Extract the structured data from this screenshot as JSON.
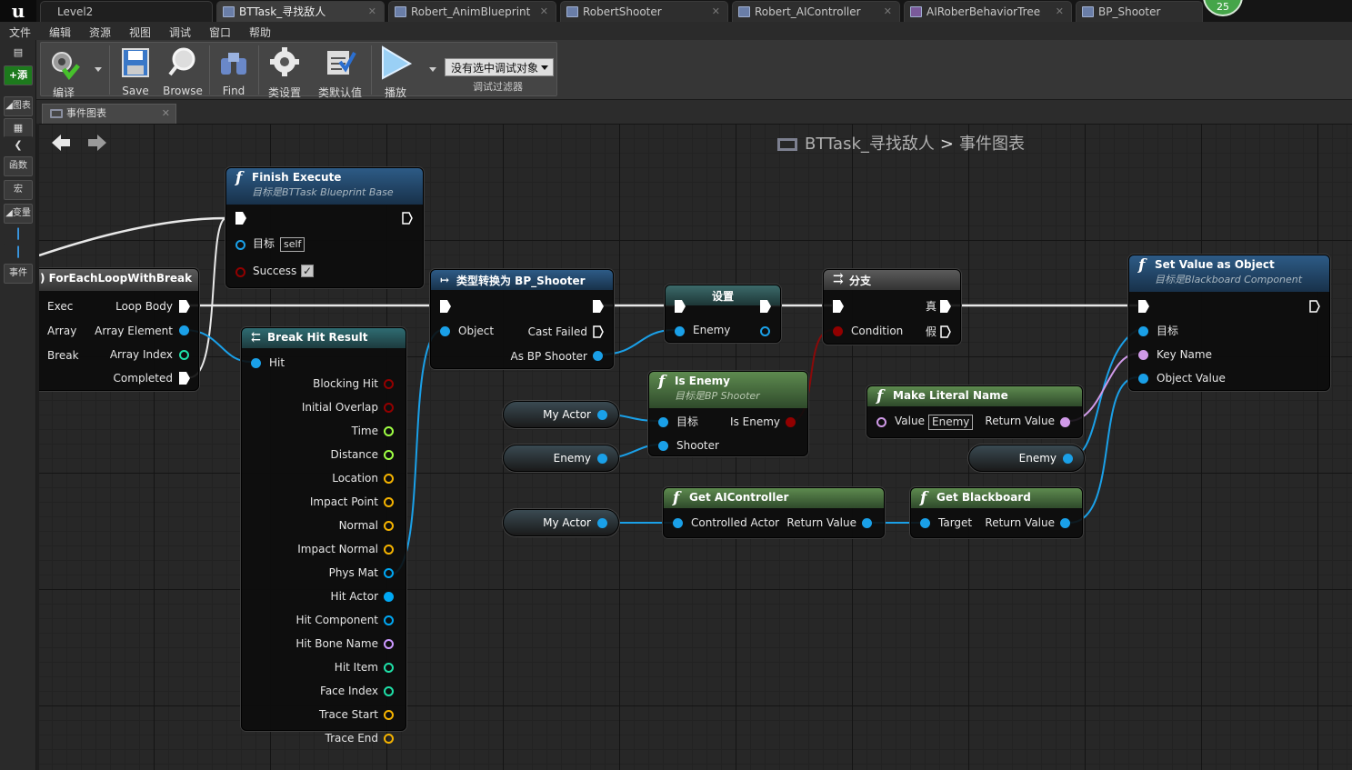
{
  "tabs": [
    {
      "label": "Level2"
    },
    {
      "label": "BTTask_寻找敌人"
    },
    {
      "label": "Robert_AnimBlueprint"
    },
    {
      "label": "RobertShooter"
    },
    {
      "label": "Robert_AIController"
    },
    {
      "label": "AIRoberBehaviorTree"
    },
    {
      "label": "BP_Shooter"
    }
  ],
  "notification_count": "25",
  "menu": [
    "文件",
    "编辑",
    "资源",
    "视图",
    "调试",
    "窗口",
    "帮助"
  ],
  "left_panel": {
    "add_label": "添",
    "items": [
      "图表",
      "函数",
      "宏",
      "变量",
      "事件"
    ]
  },
  "toolbar": {
    "compile": "编译",
    "save": "Save",
    "browse": "Browse",
    "find": "Find",
    "class_settings": "类设置",
    "class_defaults": "类默认值",
    "play": "播放",
    "debug_object": "没有选中调试对象",
    "debug_filter": "调试过滤器"
  },
  "graph_tab": "事件图表",
  "breadcrumb": {
    "asset": "BTTask_寻找敌人",
    "sep": ">",
    "graph": "事件图表"
  },
  "nodes": {
    "finish_execute": {
      "title": "Finish Execute",
      "subtitle": "目标是BTTask Blueprint Base",
      "target": "目标",
      "self": "self",
      "success": "Success"
    },
    "foreach": {
      "title": "ForEachLoopWithBreak",
      "exec": "Exec",
      "array": "Array",
      "break": "Break",
      "loop_body": "Loop Body",
      "array_element": "Array Element",
      "array_index": "Array Index",
      "completed": "Completed"
    },
    "break_hit": {
      "title": "Break Hit Result",
      "hit": "Hit",
      "outputs": [
        "Blocking Hit",
        "Initial Overlap",
        "Time",
        "Distance",
        "Location",
        "Impact Point",
        "Normal",
        "Impact Normal",
        "Phys Mat",
        "Hit Actor",
        "Hit Component",
        "Hit Bone Name",
        "Hit Item",
        "Face Index",
        "Trace Start",
        "Trace End"
      ]
    },
    "cast": {
      "title": "类型转换为 BP_Shooter",
      "object": "Object",
      "cast_failed": "Cast Failed",
      "as": "As BP Shooter"
    },
    "set": {
      "title": "设置",
      "enemy": "Enemy"
    },
    "branch": {
      "title": "分支",
      "condition": "Condition",
      "true_label": "真",
      "false_label": "假"
    },
    "set_value": {
      "title": "Set Value as Object",
      "subtitle": "目标是Blackboard Component",
      "target": "目标",
      "key_name": "Key Name",
      "object_value": "Object Value"
    },
    "is_enemy": {
      "title": "Is Enemy",
      "subtitle": "目标是BP Shooter",
      "target": "目标",
      "shooter": "Shooter",
      "is_enemy": "Is Enemy"
    },
    "make_literal": {
      "title": "Make Literal Name",
      "value": "Value",
      "value_box": "Enemy",
      "return_value": "Return Value"
    },
    "get_ai": {
      "title": "Get AIController",
      "controlled": "Controlled Actor",
      "return_value": "Return Value"
    },
    "get_bb": {
      "title": "Get Blackboard",
      "target": "Target",
      "return_value": "Return Value"
    }
  },
  "vars": {
    "my_actor_1": "My Actor",
    "enemy_1": "Enemy",
    "my_actor_2": "My Actor",
    "enemy_2": "Enemy"
  },
  "colors": {
    "exec": "#ffffff",
    "object": "#00a8f4",
    "bool": "#920000",
    "float": "#9fff44",
    "struct": "#f5b300",
    "name": "#cc99ff",
    "int": "#1fe0a8"
  }
}
